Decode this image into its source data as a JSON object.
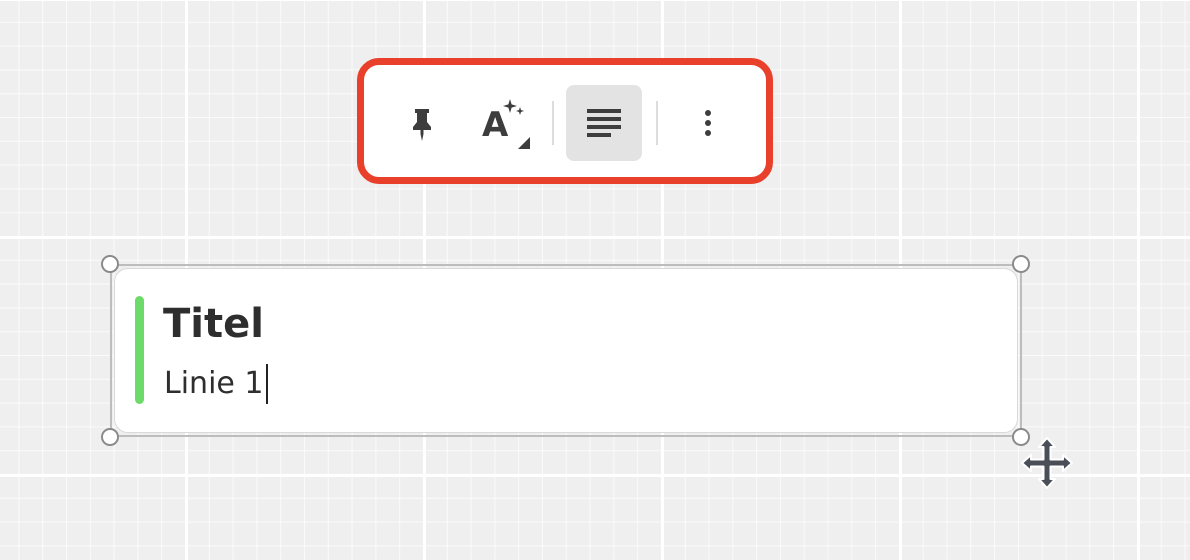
{
  "toolbar": {
    "buttons": [
      {
        "name": "pin",
        "icon": "pin-icon",
        "active": false
      },
      {
        "name": "text-style",
        "icon": "text-magic-icon",
        "active": false
      },
      {
        "name": "align",
        "icon": "align-left-icon",
        "active": true
      },
      {
        "name": "more",
        "icon": "more-vertical-icon",
        "active": false
      }
    ],
    "highlight_color": "#e8402a"
  },
  "card": {
    "title": "Titel",
    "line1": "Linie 1",
    "accent_color": "#6ddb6a"
  },
  "cursor": {
    "icon": "move-cursor-icon"
  }
}
